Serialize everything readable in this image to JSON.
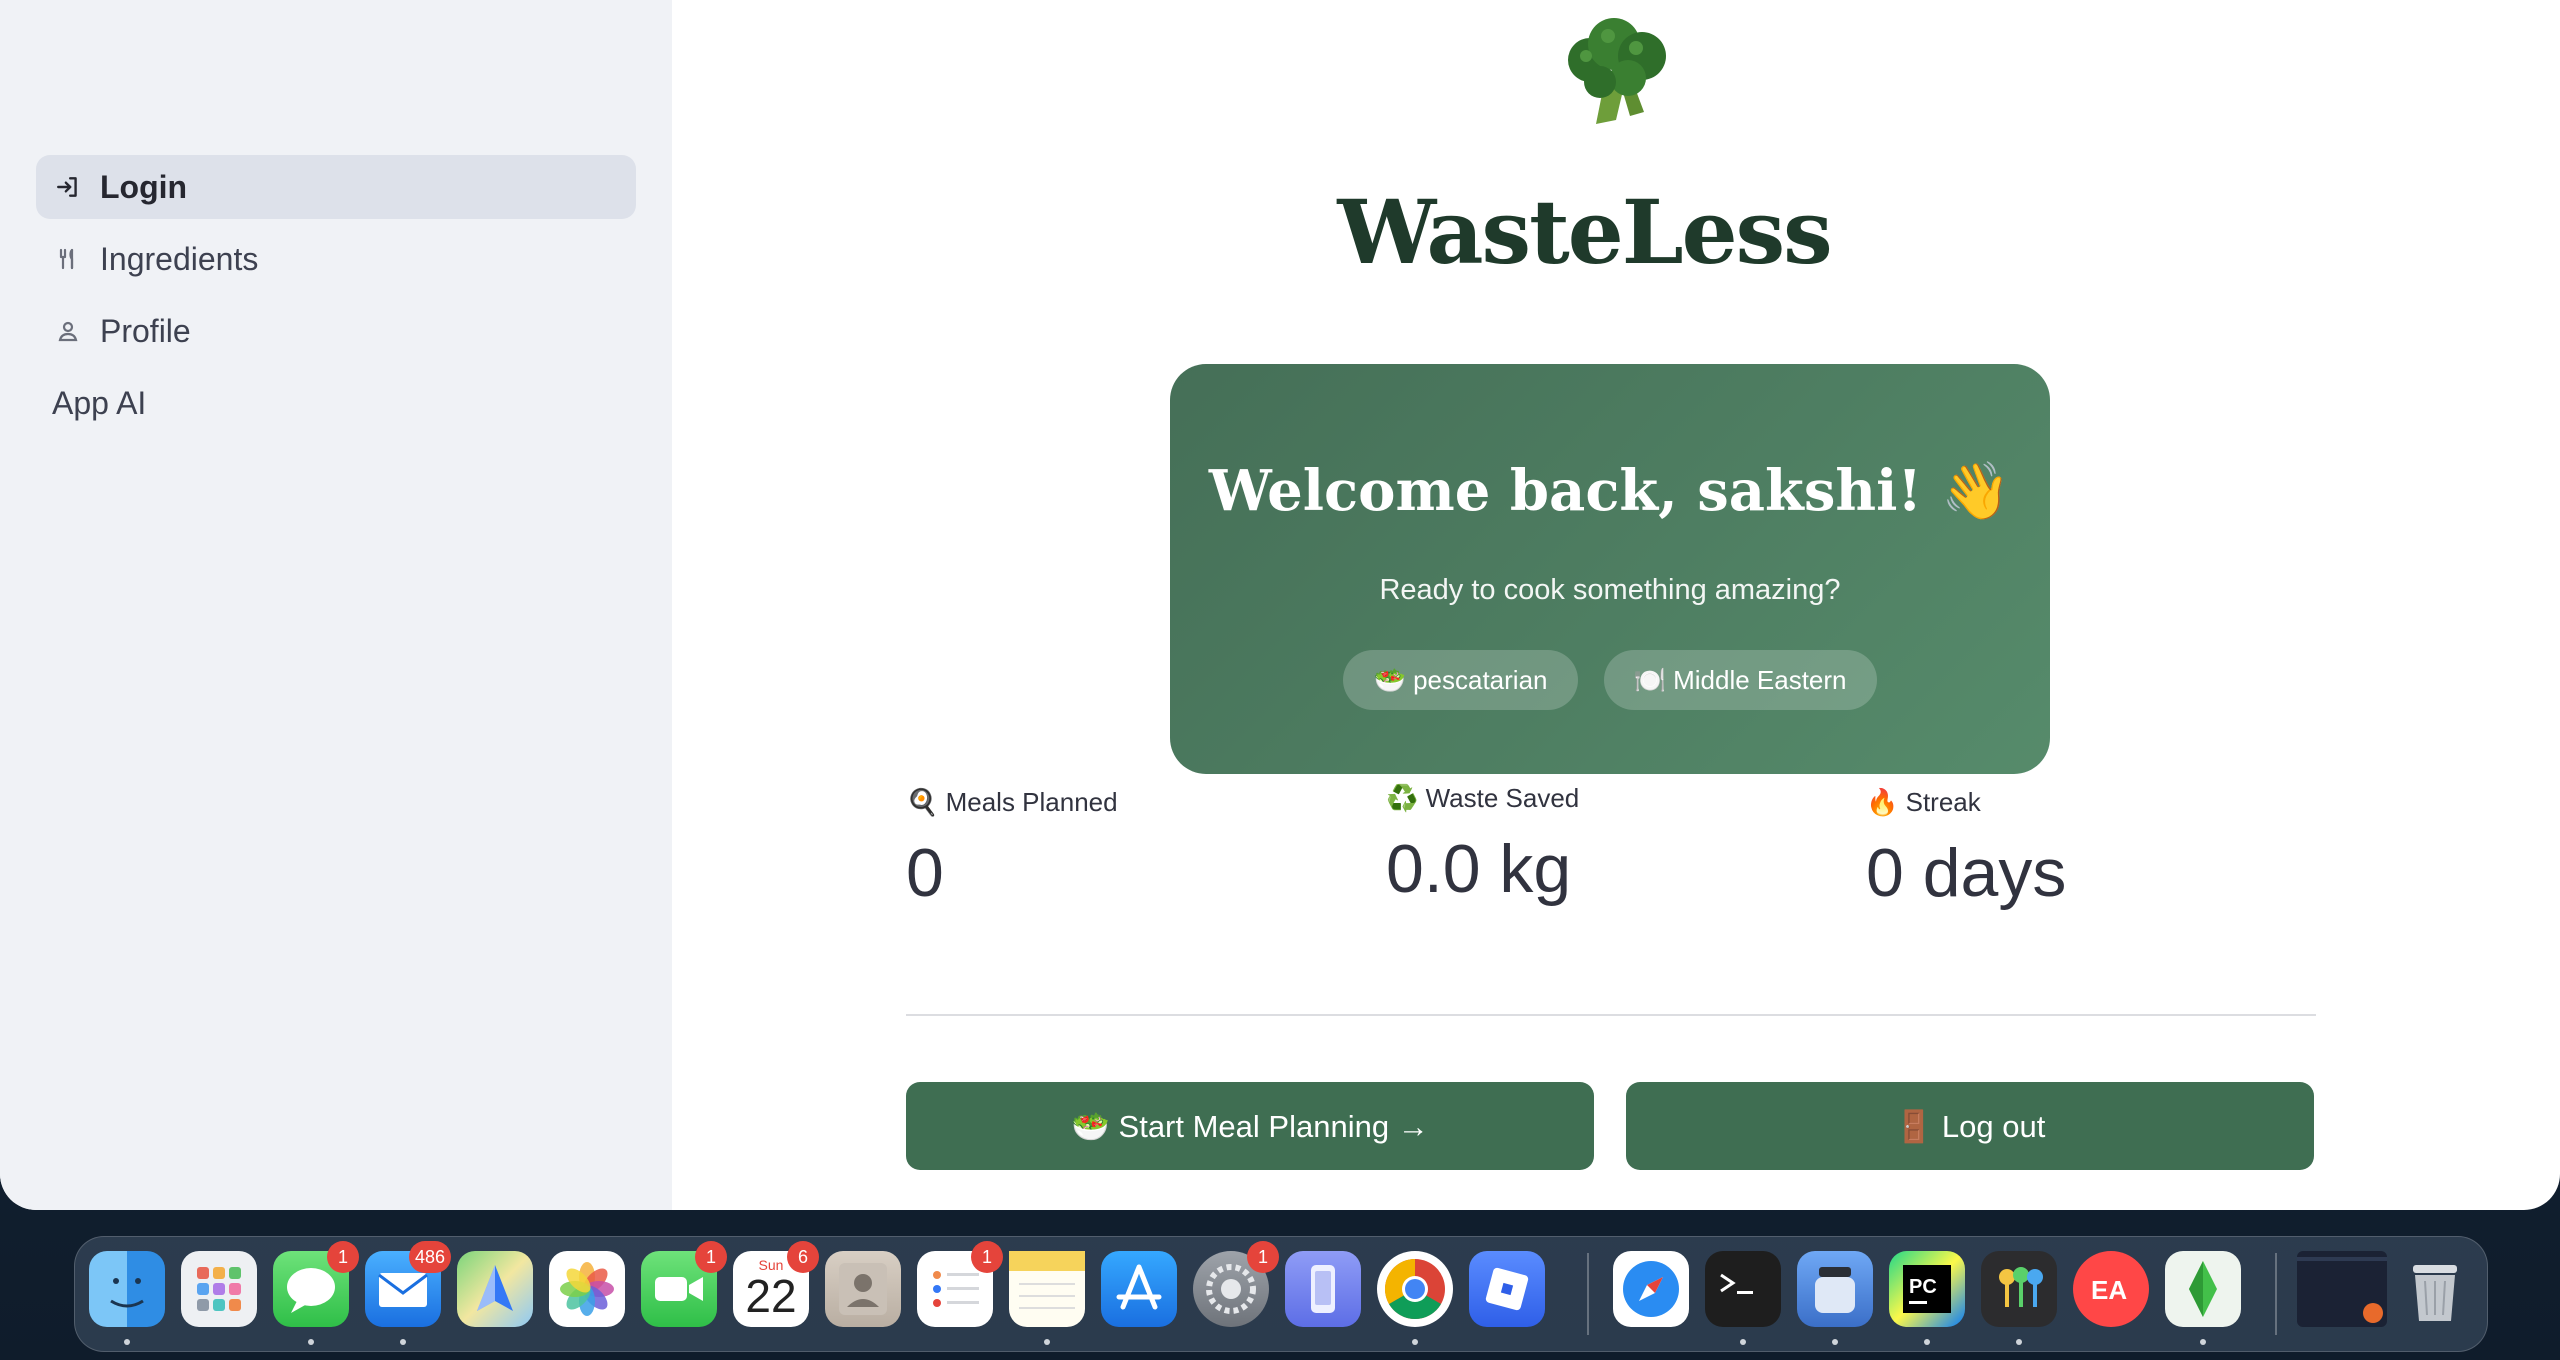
{
  "sidebar": {
    "items": [
      {
        "label": "Login",
        "icon": "login-icon",
        "active": true
      },
      {
        "label": "Ingredients",
        "icon": "fork-knife-icon",
        "active": false
      },
      {
        "label": "Profile",
        "icon": "person-icon",
        "active": false
      },
      {
        "label": "App AI",
        "icon": "",
        "active": false
      }
    ]
  },
  "main": {
    "logo_icon": "broccoli-icon",
    "title": "WasteLess",
    "card": {
      "title": "Welcome back, sakshi! 👋",
      "subtitle": "Ready to cook something amazing?",
      "chips": [
        "🥗 pescatarian",
        "🍽️ Middle Eastern"
      ]
    },
    "stats": [
      {
        "label": "🍳 Meals Planned",
        "value": "0"
      },
      {
        "label": "♻️ Waste Saved",
        "value": "0.0 kg"
      },
      {
        "label": "🔥 Streak",
        "value": "0 days"
      }
    ],
    "buttons": {
      "start": "🥗 Start Meal Planning →",
      "logout": "🚪 Log out"
    }
  },
  "dock": {
    "apps": [
      {
        "name": "Finder",
        "icon": "finder-icon",
        "badge": ""
      },
      {
        "name": "Launchpad",
        "icon": "launchpad-icon",
        "badge": ""
      },
      {
        "name": "Messages",
        "icon": "messages-icon",
        "badge": "1"
      },
      {
        "name": "Mail",
        "icon": "mail-icon",
        "badge": "486"
      },
      {
        "name": "Maps",
        "icon": "maps-icon",
        "badge": ""
      },
      {
        "name": "Photos",
        "icon": "photos-icon",
        "badge": ""
      },
      {
        "name": "FaceTime",
        "icon": "facetime-icon",
        "badge": "1"
      },
      {
        "name": "Calendar",
        "icon": "calendar-icon",
        "badge": "6",
        "day": "22",
        "weekday": "Sun"
      },
      {
        "name": "Contacts",
        "icon": "contacts-icon",
        "badge": ""
      },
      {
        "name": "Reminders",
        "icon": "reminders-icon",
        "badge": "1"
      },
      {
        "name": "Notes",
        "icon": "notes-icon",
        "badge": ""
      },
      {
        "name": "App Store",
        "icon": "app-store-icon",
        "badge": ""
      },
      {
        "name": "System Settings",
        "icon": "settings-icon",
        "badge": "1"
      },
      {
        "name": "iPhone Mirroring",
        "icon": "iphone-mirroring-icon",
        "badge": ""
      },
      {
        "name": "Chrome",
        "icon": "chrome-icon",
        "badge": ""
      },
      {
        "name": "Roblox",
        "icon": "roblox-icon",
        "badge": ""
      },
      {
        "name": "Safari",
        "icon": "safari-icon",
        "badge": ""
      },
      {
        "name": "Terminal",
        "icon": "terminal-icon",
        "badge": ""
      },
      {
        "name": "Bottle",
        "icon": "jar-icon",
        "badge": ""
      },
      {
        "name": "PyCharm",
        "icon": "pycharm-icon",
        "badge": ""
      },
      {
        "name": "Keychain",
        "icon": "keychain-icon",
        "badge": ""
      },
      {
        "name": "EA",
        "icon": "ea-icon",
        "badge": ""
      },
      {
        "name": "The Sims",
        "icon": "sims-icon",
        "badge": ""
      },
      {
        "name": "Window",
        "icon": "minimized-window-icon",
        "badge": ""
      },
      {
        "name": "Trash",
        "icon": "trash-icon",
        "badge": ""
      }
    ]
  }
}
